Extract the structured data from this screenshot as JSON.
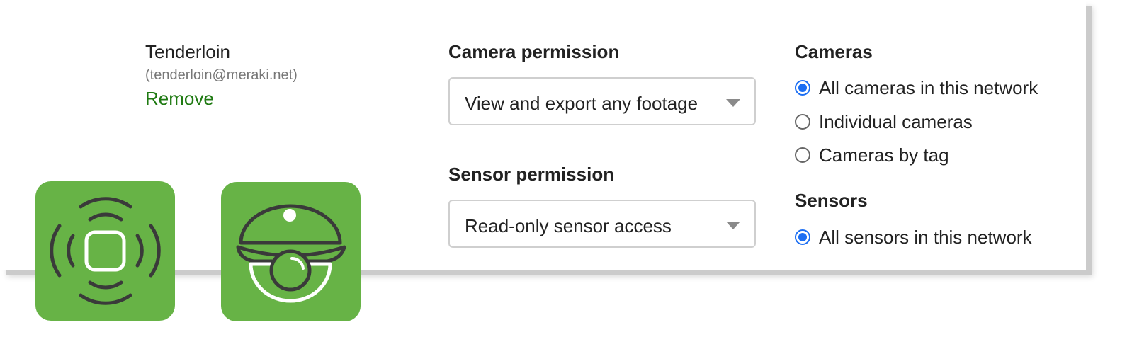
{
  "user": {
    "name": "Tenderloin",
    "email": "(tenderloin@meraki.net)",
    "remove_label": "Remove"
  },
  "camera_permission": {
    "title": "Camera permission",
    "selected": "View and export any footage"
  },
  "sensor_permission": {
    "title": "Sensor permission",
    "selected": "Read-only sensor access"
  },
  "cameras": {
    "title": "Cameras",
    "options": [
      {
        "label": "All cameras in this network",
        "checked": true
      },
      {
        "label": "Individual cameras",
        "checked": false
      },
      {
        "label": "Cameras by tag",
        "checked": false
      }
    ]
  },
  "sensors": {
    "title": "Sensors",
    "options": [
      {
        "label": "All sensors in this network",
        "checked": true
      }
    ]
  },
  "icons": {
    "sensor_tile": "sensor-icon",
    "camera_tile": "dome-camera-icon"
  },
  "colors": {
    "accent": "#1b6ef3",
    "link": "#1f7a12",
    "tile": "#67b346"
  }
}
